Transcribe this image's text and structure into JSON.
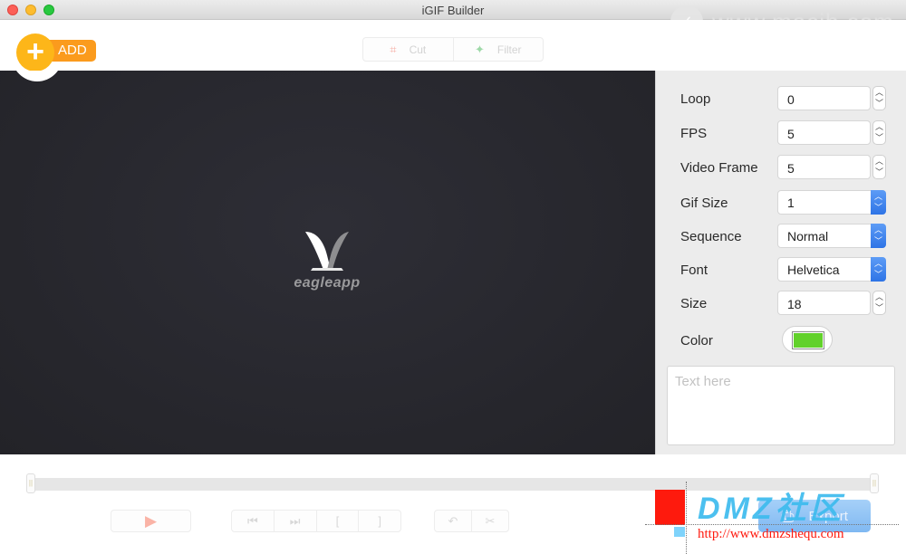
{
  "window": {
    "title": "iGIF Builder",
    "watermark_top": "www.macjb.com"
  },
  "toolbar": {
    "add_label": "ADD",
    "add_icon": "+",
    "cut_label": "Cut",
    "filter_label": "Filter",
    "cut_icon": "⌗",
    "filter_icon": "✦"
  },
  "preview": {
    "logo_text": "eagleapp"
  },
  "settings": {
    "loop": {
      "label": "Loop",
      "value": "0"
    },
    "fps": {
      "label": "FPS",
      "value": "5"
    },
    "video_frame": {
      "label": "Video Frame",
      "value": "5"
    },
    "gif_size": {
      "label": "Gif Size",
      "value": "1"
    },
    "sequence": {
      "label": "Sequence",
      "value": "Normal"
    },
    "font": {
      "label": "Font",
      "value": "Helvetica"
    },
    "size": {
      "label": "Size",
      "value": "18"
    },
    "color": {
      "label": "Color",
      "value": "#62d12b"
    },
    "text_placeholder": "Text here"
  },
  "playback": {
    "play_icon": "▶",
    "first_frame_icon": "⏮",
    "last_frame_icon": "⏭",
    "mark_in": "[",
    "mark_out": "]",
    "undo_icon": "↶",
    "cut_icon": "✂",
    "export_label": "Export",
    "export_icon": "⎙",
    "range_start_percent": 0,
    "range_end_percent": 100
  },
  "overlay": {
    "dmz_title": "DMZ社区",
    "dmz_url": "http://www.dmzshequ.com"
  }
}
